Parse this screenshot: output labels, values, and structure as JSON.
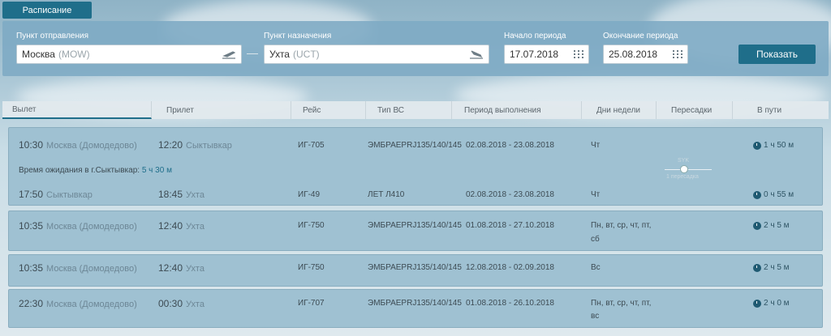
{
  "tab_label": "Расписание",
  "search": {
    "origin_label": "Пункт отправления",
    "origin_city": "Москва",
    "origin_code": "(MOW)",
    "destination_label": "Пункт назначения",
    "destination_city": "Ухта",
    "destination_code": "(UCT)",
    "start_label": "Начало периода",
    "start_value": "17.07.2018",
    "end_label": "Окончание периода",
    "end_value": "25.08.2018",
    "show_button": "Показать"
  },
  "columns": [
    "Вылет",
    "Прилет",
    "Рейс",
    "Тип ВС",
    "Период выполнения",
    "Дни недели",
    "Пересадки",
    "В пути"
  ],
  "flights": [
    {
      "legs": [
        {
          "dep_time": "10:30",
          "dep_airport": "Москва (Домодедово)",
          "arr_time": "12:20",
          "arr_airport": "Сыктывкар",
          "flight": "ИГ-705",
          "aircraft": "ЭМБРАЕРRJ135/140/145",
          "period": "02.08.2018 - 23.08.2018",
          "days": "Чт",
          "duration": "1 ч 50 м"
        },
        {
          "dep_time": "17:50",
          "dep_airport": "Сыктывкар",
          "arr_time": "18:45",
          "arr_airport": "Ухта",
          "flight": "ИГ-49",
          "aircraft": "ЛЕТ Л410",
          "period": "02.08.2018 - 23.08.2018",
          "days": "Чт",
          "duration": "0 ч 55 м"
        }
      ],
      "wait_label": "Время ожидания в г.Сыктывкар:",
      "wait_value": "5 ч 30 м",
      "transfer_top": "SYK",
      "transfer_bottom": "1 пересадка"
    },
    {
      "dep_time": "10:35",
      "dep_airport": "Москва (Домодедово)",
      "arr_time": "12:40",
      "arr_airport": "Ухта",
      "flight": "ИГ-750",
      "aircraft": "ЭМБРАЕРRJ135/140/145",
      "period": "01.08.2018 - 27.10.2018",
      "days_line1": "Пн, вт, ср, чт, пт,",
      "days_line2": "сб",
      "duration": "2 ч 5 м"
    },
    {
      "dep_time": "10:35",
      "dep_airport": "Москва (Домодедово)",
      "arr_time": "12:40",
      "arr_airport": "Ухта",
      "flight": "ИГ-750",
      "aircraft": "ЭМБРАЕРRJ135/140/145",
      "period": "12.08.2018 - 02.09.2018",
      "days_line1": "Вс",
      "days_line2": "",
      "duration": "2 ч 5 м"
    },
    {
      "dep_time": "22:30",
      "dep_airport": "Москва (Домодедово)",
      "arr_time": "00:30",
      "arr_airport": "Ухта",
      "flight": "ИГ-707",
      "aircraft": "ЭМБРАЕРRJ135/140/145",
      "period": "01.08.2018 - 26.10.2018",
      "days_line1": "Пн, вт, ср, чт, пт,",
      "days_line2": "вс",
      "duration": "2 ч 0 м"
    }
  ],
  "icons": {
    "departure": "plane-takeoff-icon",
    "arrival": "plane-landing-icon",
    "calendar": "calendar-grid-icon",
    "duration": "clock-icon"
  },
  "colors": {
    "accent": "#1f6e8a",
    "card": "#9fc1d2"
  }
}
